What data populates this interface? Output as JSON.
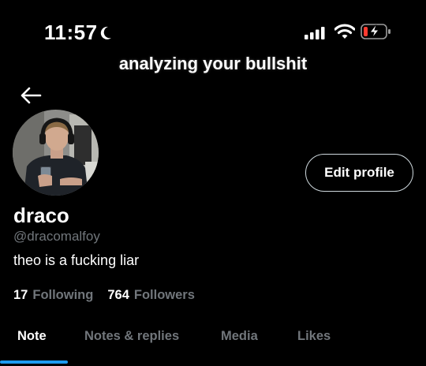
{
  "status_bar": {
    "time": "11:57"
  },
  "overlay": {
    "caption": "analyzing your bullshit"
  },
  "profile": {
    "name": "draco",
    "handle": "@dracomalfoy",
    "bio": "theo is a fucking liar",
    "edit_label": "Edit profile",
    "following_count": "17",
    "following_label": "Following",
    "followers_count": "764",
    "followers_label": "Followers"
  },
  "tabs": [
    {
      "label": "Note",
      "active": true
    },
    {
      "label": "Notes & replies",
      "active": false
    },
    {
      "label": "Media",
      "active": false
    },
    {
      "label": "Likes",
      "active": false
    }
  ],
  "colors": {
    "accent": "#1d9bf0",
    "muted": "#71767b",
    "background": "#000000"
  }
}
